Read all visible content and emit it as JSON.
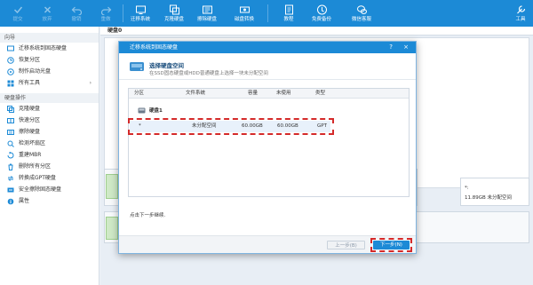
{
  "toolbar": {
    "buttons": [
      {
        "label": "提交",
        "icon": "check-icon",
        "enabled": false
      },
      {
        "label": "放弃",
        "icon": "cancel-icon",
        "enabled": false
      },
      {
        "label": "撤销",
        "icon": "undo-icon",
        "enabled": false
      },
      {
        "label": "重做",
        "icon": "redo-icon",
        "enabled": false
      },
      {
        "label": "迁移系统",
        "icon": "migrate-os-icon",
        "enabled": true
      },
      {
        "label": "克隆硬盘",
        "icon": "clone-disk-icon",
        "enabled": true
      },
      {
        "label": "擦除硬盘",
        "icon": "wipe-disk-icon",
        "enabled": true
      },
      {
        "label": "磁盘转换",
        "icon": "convert-disk-icon",
        "enabled": true
      },
      {
        "label": "教程",
        "icon": "tutorial-icon",
        "enabled": true
      },
      {
        "label": "免费备份",
        "icon": "backup-icon",
        "enabled": true
      },
      {
        "label": "微信客服",
        "icon": "wechat-icon",
        "enabled": true
      },
      {
        "label": "工具",
        "icon": "tools-icon",
        "enabled": true
      }
    ]
  },
  "sidebar": {
    "wizard_title": "向导",
    "wizard_items": [
      {
        "label": "迁移系统到固态硬盘",
        "icon": "migrate-icon"
      },
      {
        "label": "恢复分区",
        "icon": "recover-icon"
      },
      {
        "label": "制作启动光盘",
        "icon": "boot-disc-icon"
      },
      {
        "label": "所有工具",
        "icon": "all-tools-icon"
      }
    ],
    "disk_ops_title": "硬盘操作",
    "disk_ops_items": [
      {
        "label": "克隆硬盘",
        "icon": "clone-icon"
      },
      {
        "label": "快速分区",
        "icon": "quick-partition-icon"
      },
      {
        "label": "擦除硬盘",
        "icon": "erase-icon"
      },
      {
        "label": "检测坏扇区",
        "icon": "bad-sector-icon"
      },
      {
        "label": "重建MBR",
        "icon": "rebuild-mbr-icon"
      },
      {
        "label": "删除所有分区",
        "icon": "delete-partitions-icon"
      },
      {
        "label": "转换成GPT硬盘",
        "icon": "gpt-icon"
      },
      {
        "label": "安全擦除固态硬盘",
        "icon": "ssd-erase-icon"
      },
      {
        "label": "属性",
        "icon": "properties-icon"
      }
    ]
  },
  "main": {
    "disk_label": "硬盘0",
    "right_panel_value": "11.89GB 未分配空间",
    "right_panel_star": "*:"
  },
  "dialog": {
    "title": "迁移系统到固态硬盘",
    "help": "?",
    "close": "×",
    "heading": "选择硬盘空间",
    "description": "在SSD固态硬盘或HDD普通硬盘上选择一块未分配空间",
    "columns": [
      "分区",
      "文件系统",
      "容量",
      "未使用",
      "类型"
    ],
    "disk_name": "硬盘1",
    "partition_row": {
      "partition": "*",
      "file_system": "未分配空间",
      "capacity": "60.00GB",
      "unused": "60.00GB",
      "type": "GPT"
    },
    "footer_text": "点击下一步继续.",
    "prev_button": "上一步(B)",
    "next_button": "下一步(N)"
  },
  "colors": {
    "accent": "#1c8ad6",
    "highlight_dash": "#d42a2a"
  }
}
